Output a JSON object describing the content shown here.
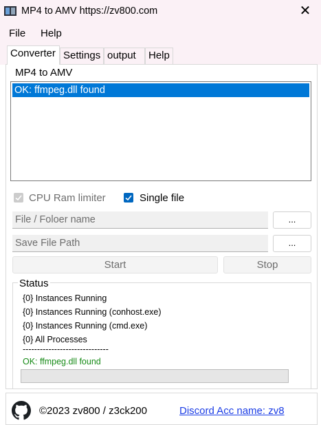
{
  "window": {
    "title": "MP4 to AMV https://zv800.com"
  },
  "menu": [
    "File",
    "Help"
  ],
  "tabs": [
    "Converter",
    "Settings",
    "output",
    "Help"
  ],
  "converter": {
    "group_label": "MP4 to AMV",
    "list_items": [
      "OK: ffmpeg.dll found"
    ],
    "cpu_checkbox": {
      "label": "CPU  Ram limiter",
      "checked": true,
      "enabled": false
    },
    "single_file_checkbox": {
      "label": "Single file",
      "checked": true,
      "enabled": true
    },
    "file_field": {
      "placeholder": "File / Foloer name",
      "value": ""
    },
    "browse_file_label": "...",
    "save_field": {
      "placeholder": "Save File Path",
      "value": ""
    },
    "browse_save_label": "...",
    "start_label": "Start",
    "stop_label": "Stop"
  },
  "status": {
    "label": "Status",
    "lines": [
      "{0} Instances Running",
      "{0} Instances Running (conhost.exe)",
      "{0} Instances Running (cmd.exe)",
      "{0} All Processes",
      "------------------------------",
      "OK: ffmpeg.dll found"
    ],
    "ok_color": "#168a16",
    "progress_percent": 0
  },
  "footer": {
    "copyright": "©2023 zv800 / z3ck200",
    "discord_link": "Discord Acc name: zv8",
    "icon": "github-icon"
  },
  "colors": {
    "accent": "#0078d7",
    "titlebar": "#fbf1f6",
    "link": "#1a3ce5"
  }
}
